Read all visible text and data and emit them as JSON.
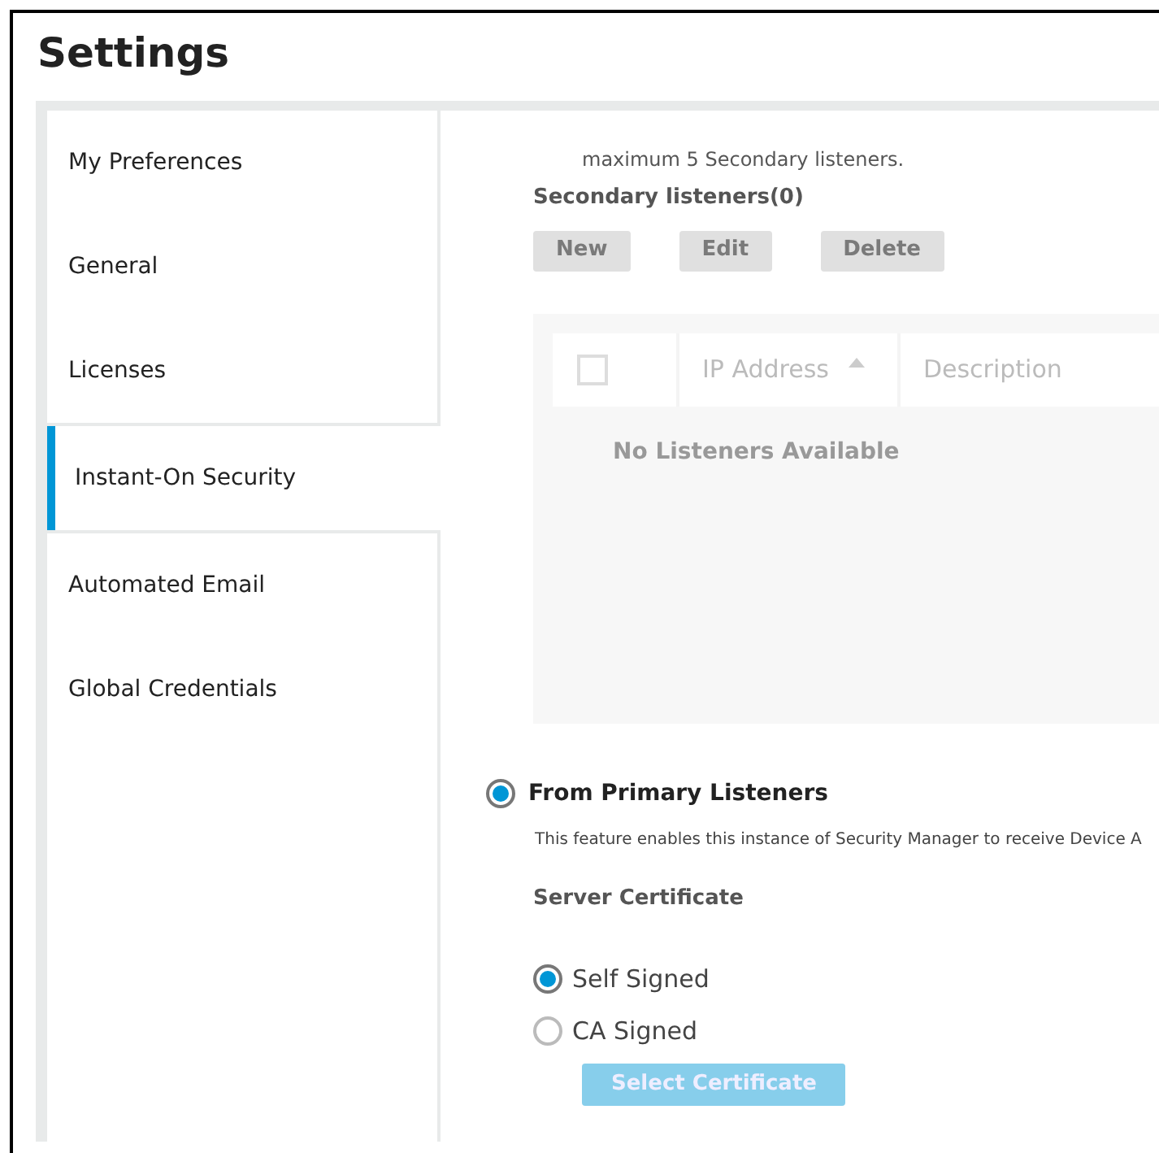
{
  "title": "Settings",
  "sidebar": {
    "items": [
      {
        "label": "My Preferences",
        "selected": false
      },
      {
        "label": "General",
        "selected": false
      },
      {
        "label": "Licenses",
        "selected": false
      },
      {
        "label": "Instant-On Security",
        "selected": true
      },
      {
        "label": "Automated Email",
        "selected": false
      },
      {
        "label": "Global Credentials",
        "selected": false
      }
    ]
  },
  "secondary": {
    "note": "maximum  5 Secondary listeners.",
    "heading": "Secondary listeners(0)",
    "buttons": [
      {
        "label": "New",
        "disabled": true
      },
      {
        "label": "Edit",
        "disabled": true
      },
      {
        "label": "Delete",
        "disabled": true
      }
    ],
    "table": {
      "select_all": {
        "checked": false
      },
      "columns": [
        {
          "label": "IP Address",
          "sorted": true
        },
        {
          "label": "Description",
          "sorted": false
        }
      ],
      "empty_message": "No Listeners Available"
    }
  },
  "primary": {
    "label": "From Primary Listeners",
    "selected": true,
    "description": "This feature enables this instance of Security Manager to receive Device A",
    "certificate_heading": "Server Certificate",
    "options": [
      {
        "label": "Self Signed",
        "selected": true
      },
      {
        "label": "CA Signed",
        "selected": false
      }
    ],
    "button": {
      "label": "Select Certificate",
      "disabled": true
    }
  }
}
